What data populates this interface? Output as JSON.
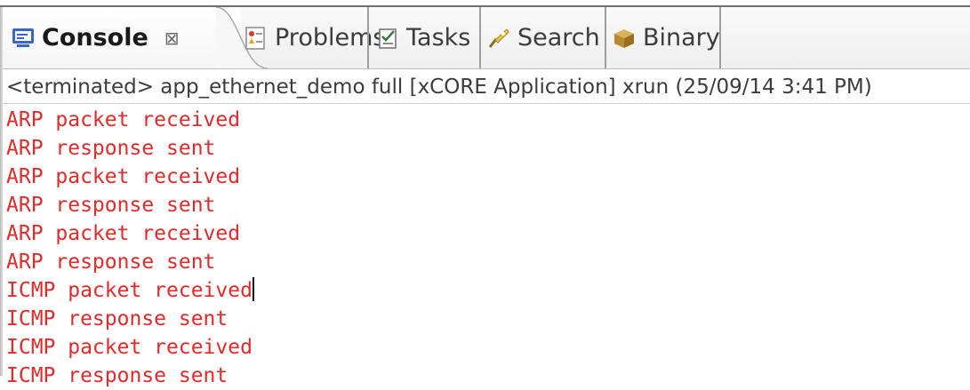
{
  "tabs": [
    {
      "label": "Console",
      "icon": "console-icon",
      "active": true,
      "close": "⊠"
    },
    {
      "label": "Problems",
      "icon": "problems-icon"
    },
    {
      "label": "Tasks",
      "icon": "tasks-icon"
    },
    {
      "label": "Search",
      "icon": "search-icon"
    },
    {
      "label": "Binary",
      "icon": "binary-icon"
    }
  ],
  "status": "<terminated> app_ethernet_demo full [xCORE Application] xrun (25/09/14 3:41 PM)",
  "output_lines": [
    "ARP packet received",
    "ARP response sent",
    "ARP packet received",
    "ARP response sent",
    "ARP packet received",
    "ARP response sent",
    "ICMP packet received",
    "ICMP response sent",
    "ICMP packet received",
    "ICMP response sent"
  ],
  "caret_line": 6,
  "colors": {
    "output_text": "#e02b2b",
    "console_icon": "#3b66c4"
  }
}
